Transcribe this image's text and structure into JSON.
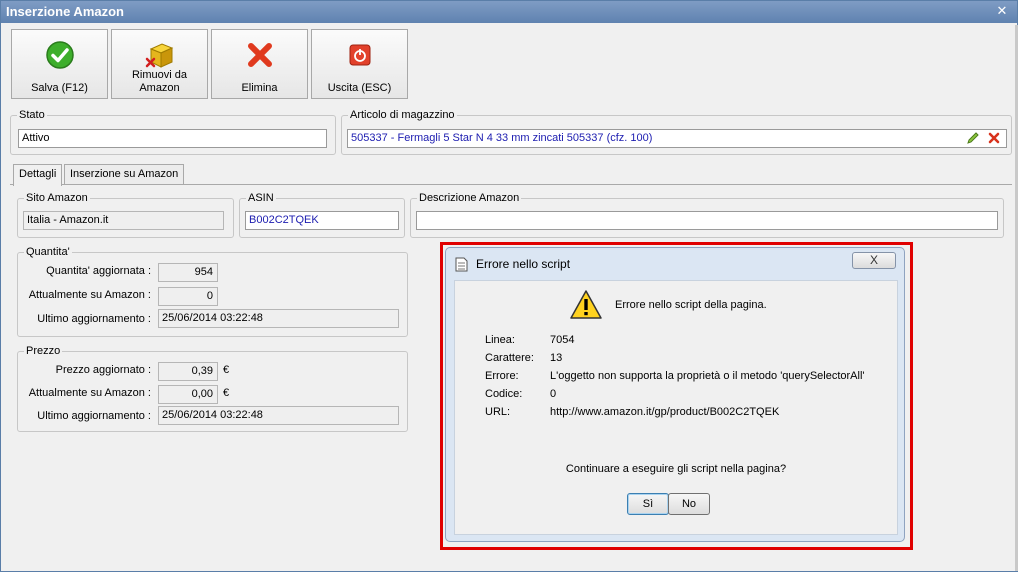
{
  "window": {
    "title": "Inserzione Amazon"
  },
  "toolbar": {
    "save": "Salva (F12)",
    "remove": "Rimuovi da\nAmazon",
    "delete": "Elimina",
    "exit": "Uscita (ESC)"
  },
  "stato": {
    "legend": "Stato",
    "value": "Attivo"
  },
  "articolo": {
    "legend": "Articolo di magazzino",
    "value": "505337 - Fermagli 5 Star N 4 33 mm zincati 505337 (cfz. 100)"
  },
  "tabs": [
    {
      "label": "Dettagli"
    },
    {
      "label": "Inserzione su Amazon"
    }
  ],
  "sito": {
    "legend": "Sito Amazon",
    "value": "Italia - Amazon.it"
  },
  "asin": {
    "legend": "ASIN",
    "value": "B002C2TQEK"
  },
  "descrizione": {
    "legend": "Descrizione Amazon",
    "value": ""
  },
  "quantita": {
    "legend": "Quantita'",
    "updated_label": "Quantita' aggiornata :",
    "updated_value": "954",
    "current_label": "Attualmente su Amazon :",
    "current_value": "0",
    "last_label": "Ultimo aggiornamento :",
    "last_value": "25/06/2014 03:22:48"
  },
  "prezzo": {
    "legend": "Prezzo",
    "updated_label": "Prezzo aggiornato :",
    "updated_value": "0,39",
    "current_label": "Attualmente su Amazon :",
    "current_value": "0,00",
    "currency": "€",
    "last_label": "Ultimo aggiornamento :",
    "last_value": "25/06/2014 03:22:48"
  },
  "dialog": {
    "title": "Errore nello script",
    "close_label": "X",
    "message": "Errore nello script della pagina.",
    "rows": [
      {
        "key": "Linea:",
        "value": "7054"
      },
      {
        "key": "Carattere:",
        "value": "13"
      },
      {
        "key": "Errore:",
        "value": "L'oggetto non supporta la proprietà o il metodo 'querySelectorAll'"
      },
      {
        "key": "Codice:",
        "value": "0"
      },
      {
        "key": "URL:",
        "value": "http://www.amazon.it/gp/product/B002C2TQEK"
      }
    ],
    "question": "Continuare a eseguire gli script nella pagina?",
    "yes": "Sì",
    "no": "No"
  },
  "colors": {
    "highlight": "#e00000",
    "titlebar": "#6f8fbb",
    "link_text": "#1c1cb0"
  }
}
